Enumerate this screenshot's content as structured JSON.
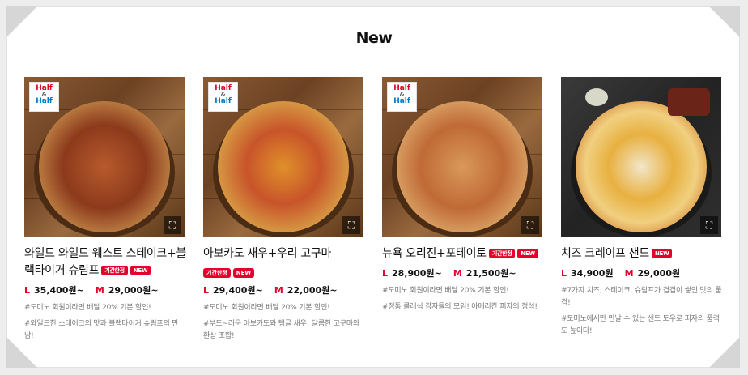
{
  "section": {
    "title": "New"
  },
  "badge": {
    "line1": "Half",
    "amp": "&",
    "line2": "Half"
  },
  "colors": {
    "accent": "#e4002b",
    "halfBlue": "#0078c8"
  },
  "cards": [
    {
      "name": "와일드 와일드 웨스트 스테이크+블랙타이거 슈림프",
      "tags": [
        "기간한정",
        "NEW"
      ],
      "half_badge": true,
      "price_l_label": "L",
      "price_l": "35,400원~",
      "price_m_label": "M",
      "price_m": "29,000원~",
      "desc1": "#도미노 회원이라면 배달 20% 기본 할인!",
      "desc2": "#와일드한 스테이크의 맛과 블랙타이거 슈림프의 만남!"
    },
    {
      "name": "아보카도 새우+우리 고구마",
      "tags": [
        "기간한정",
        "NEW"
      ],
      "half_badge": true,
      "price_l_label": "L",
      "price_l": "29,400원~",
      "price_m_label": "M",
      "price_m": "22,000원~",
      "desc1": "#도미노 회원이라면 배달 20% 기본 할인!",
      "desc2": "#부드~러운 아보카도와 탱글 새우! 달콤한 고구마와 환상 조합!"
    },
    {
      "name": "뉴욕 오리진+포테이토",
      "tags": [
        "기간한정",
        "NEW"
      ],
      "half_badge": true,
      "price_l_label": "L",
      "price_l": "28,900원~",
      "price_m_label": "M",
      "price_m": "21,500원~",
      "desc1": "#도미노 회원이라면 배달 20% 기본 할인!",
      "desc2": "#정통 클래식 강자들의 모임! 아메리칸 피자의 정석!"
    },
    {
      "name": "치즈 크레이프 샌드",
      "tags": [
        "NEW"
      ],
      "half_badge": false,
      "price_l_label": "L",
      "price_l": "34,900원",
      "price_m_label": "M",
      "price_m": "29,000원",
      "desc1": "#7가지 치즈, 스테이크, 슈림프가 겹겹이 쌓인 맛의 품격!",
      "desc2": "#도미노에서만 만날 수 있는 샌드 도우로 피자의 품격도 높이다!"
    }
  ]
}
